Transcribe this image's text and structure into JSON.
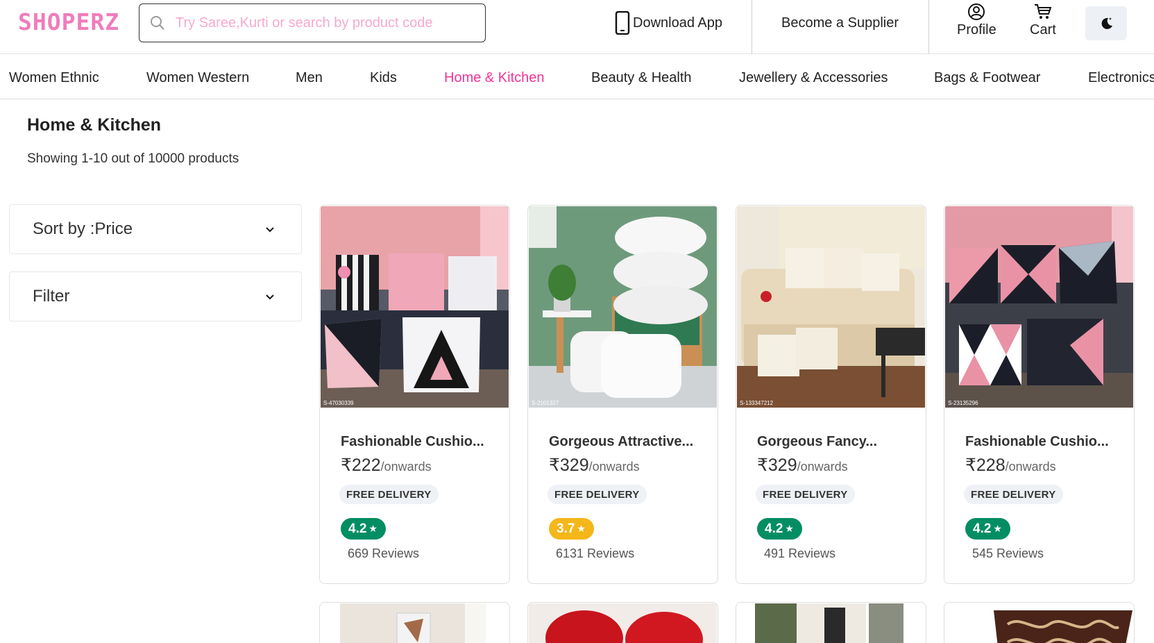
{
  "header": {
    "logo": "SHOPERZ",
    "search_placeholder": "Try Saree,Kurti or search by product code",
    "download_app": "Download App",
    "become_supplier": "Become a Supplier",
    "profile": "Profile",
    "cart": "Cart"
  },
  "nav": {
    "items": [
      "Women Ethnic",
      "Women Western",
      "Men",
      "Kids",
      "Home & Kitchen",
      "Beauty & Health",
      "Jewellery & Accessories",
      "Bags & Footwear",
      "Electronics"
    ],
    "active": "Home & Kitchen"
  },
  "page": {
    "title": "Home & Kitchen",
    "result_count": "Showing 1-10 out of 10000 products"
  },
  "sidebar": {
    "sort_label": "Sort by :Price",
    "filter_label": "Filter"
  },
  "products": [
    {
      "name": "Fashionable Cushio...",
      "price": "₹222",
      "price_suffix": "/onwards",
      "delivery": "FREE DELIVERY",
      "rating": "4.2",
      "reviews": "669 Reviews",
      "rating_color": "#038d63",
      "image": "pink-black-geometric-cushions",
      "image_code": "S-47030339"
    },
    {
      "name": "Gorgeous Attractive...",
      "price": "₹329",
      "price_suffix": "/onwards",
      "delivery": "FREE DELIVERY",
      "rating": "3.7",
      "reviews": "6131 Reviews",
      "rating_color": "#f4b619",
      "image": "white-pillows-green-chair",
      "image_code": "S-2101327"
    },
    {
      "name": "Gorgeous Fancy...",
      "price": "₹329",
      "price_suffix": "/onwards",
      "delivery": "FREE DELIVERY",
      "rating": "4.2",
      "reviews": "491 Reviews",
      "rating_color": "#038d63",
      "image": "gold-leaf-cushions-beige-sofa",
      "image_code": "S-133347212"
    },
    {
      "name": "Fashionable Cushio...",
      "price": "₹228",
      "price_suffix": "/onwards",
      "delivery": "FREE DELIVERY",
      "rating": "4.2",
      "reviews": "545 Reviews",
      "rating_color": "#038d63",
      "image": "triangle-pattern-cushions",
      "image_code": "S-23135296"
    }
  ],
  "colors": {
    "brand": "#f43397",
    "logo": "#f07cbc",
    "rating_good": "#038d63",
    "rating_avg": "#f4b619"
  }
}
